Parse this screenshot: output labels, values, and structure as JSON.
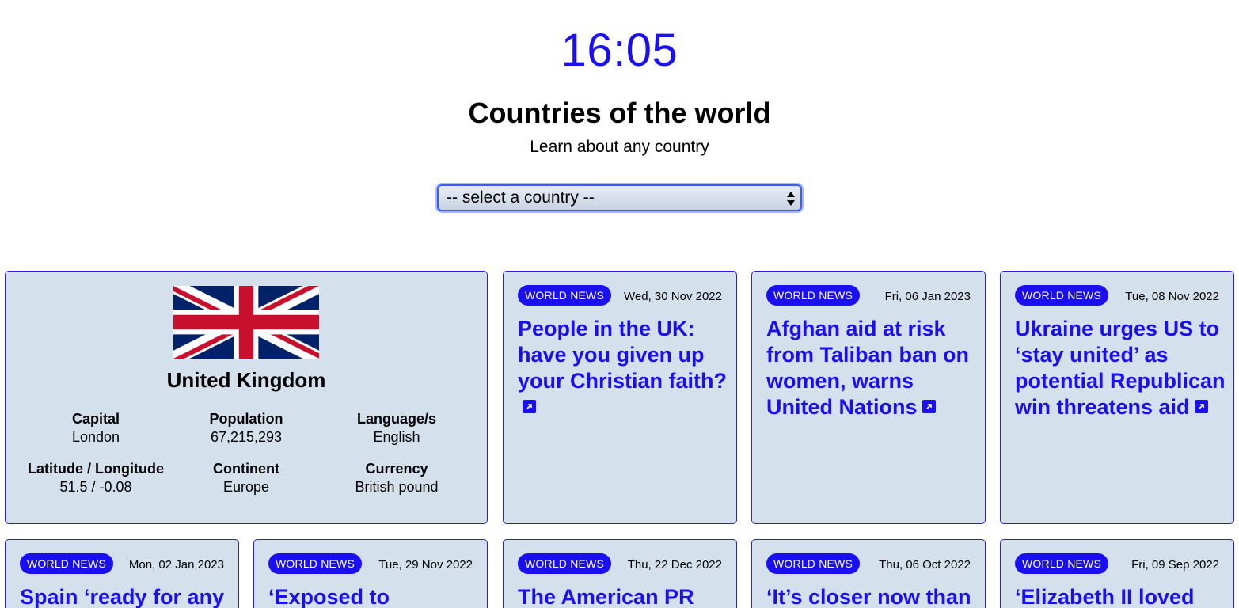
{
  "clock": "16:05",
  "page": {
    "title": "Countries of the world",
    "subtitle": "Learn about any country"
  },
  "country_select": {
    "selected": "-- select a country --"
  },
  "country": {
    "name": "United Kingdom",
    "facts": [
      {
        "label": "Capital",
        "value": "London"
      },
      {
        "label": "Population",
        "value": "67,215,293"
      },
      {
        "label": "Language/s",
        "value": "English"
      },
      {
        "label": "Latitude / Longitude",
        "value": "51.5 / -0.08"
      },
      {
        "label": "Continent",
        "value": "Europe"
      },
      {
        "label": "Currency",
        "value": "British pound"
      }
    ],
    "flag_icon": "uk-flag"
  },
  "colors": {
    "accent": "#1a0ff0",
    "card_bg": "#d4e0ec"
  },
  "news": [
    {
      "badge": "WORLD NEWS",
      "date": "Wed, 30 Nov 2022",
      "headline": "People in the UK: have you given up your Christian faith?"
    },
    {
      "badge": "WORLD NEWS",
      "date": "Fri, 06 Jan 2023",
      "headline": "Afghan aid at risk from Taliban ban on women, warns United Nations"
    },
    {
      "badge": "WORLD NEWS",
      "date": "Tue, 08 Nov 2022",
      "headline": "Ukraine urges US to ‘stay united’ as potential Republican win threatens aid"
    },
    {
      "badge": "WORLD NEWS",
      "date": "Mon, 02 Jan 2023",
      "headline": "Spain ‘ready for any"
    },
    {
      "badge": "WORLD NEWS",
      "date": "Tue, 29 Nov 2022",
      "headline": "‘Exposed to"
    },
    {
      "badge": "WORLD NEWS",
      "date": "Thu, 22 Dec 2022",
      "headline": "The American PR"
    },
    {
      "badge": "WORLD NEWS",
      "date": "Thu, 06 Oct 2022",
      "headline": "‘It’s closer now than"
    },
    {
      "badge": "WORLD NEWS",
      "date": "Fri, 09 Sep 2022",
      "headline": "‘Elizabeth II loved"
    }
  ]
}
